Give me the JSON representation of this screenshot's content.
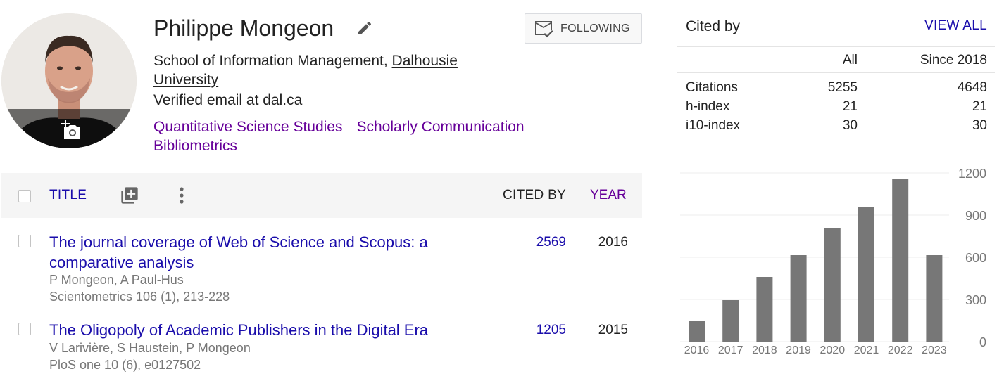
{
  "profile": {
    "name": "Philippe Mongeon",
    "affiliation_prefix": "School of Information Management, ",
    "affiliation_link": "Dalhousie University",
    "email": "Verified email at dal.ca",
    "interests": [
      "Quantitative Science Studies",
      "Scholarly Communication",
      "Bibliometrics"
    ],
    "follow_label": "FOLLOWING"
  },
  "table": {
    "title_header": "TITLE",
    "cited_by_header": "CITED BY",
    "year_header": "YEAR",
    "rows": [
      {
        "title": "The journal coverage of Web of Science and Scopus: a comparative analysis",
        "authors": "P Mongeon, A Paul-Hus",
        "venue": "Scientometrics 106 (1), 213-228",
        "cited_by": "2569",
        "year": "2016"
      },
      {
        "title": "The Oligopoly of Academic Publishers in the Digital Era",
        "authors": "V Larivière, S Haustein, P Mongeon",
        "venue": "PloS one 10 (6), e0127502",
        "cited_by": "1205",
        "year": "2015"
      }
    ]
  },
  "cited_by": {
    "title": "Cited by",
    "view_all": "VIEW ALL",
    "col_all": "All",
    "col_since": "Since 2018",
    "stats": [
      {
        "label": "Citations",
        "all": "5255",
        "since": "4648"
      },
      {
        "label": "h-index",
        "all": "21",
        "since": "21"
      },
      {
        "label": "i10-index",
        "all": "30",
        "since": "30"
      }
    ]
  },
  "colors": {
    "link": "#1a0dab",
    "visited": "#660099",
    "bar": "#777777"
  },
  "chart_data": {
    "type": "bar",
    "categories": [
      "2016",
      "2017",
      "2018",
      "2019",
      "2020",
      "2021",
      "2022",
      "2023"
    ],
    "values": [
      145,
      295,
      460,
      615,
      810,
      960,
      1155,
      615
    ],
    "ylim": [
      0,
      1200
    ],
    "yticks": [
      0,
      300,
      600,
      900,
      1200
    ],
    "grid": true,
    "y_axis_side": "right"
  }
}
